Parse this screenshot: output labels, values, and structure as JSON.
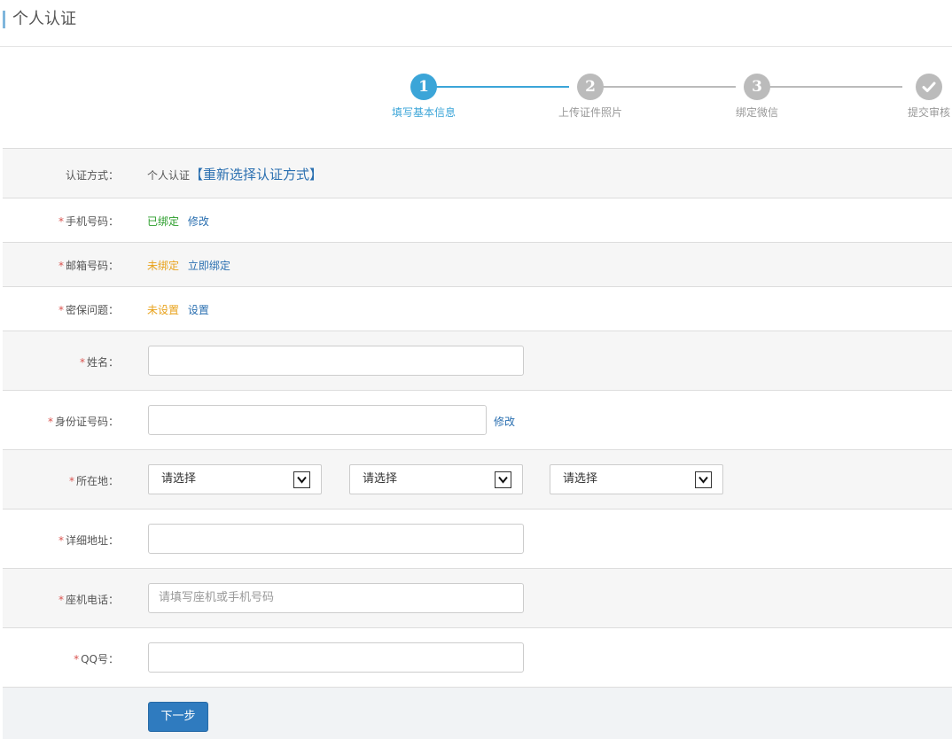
{
  "page": {
    "title": "个人认证"
  },
  "steps": [
    {
      "num": "1",
      "label": "填写基本信息",
      "state": "active"
    },
    {
      "num": "2",
      "label": "上传证件照片",
      "state": "pending"
    },
    {
      "num": "3",
      "label": "绑定微信",
      "state": "pending"
    },
    {
      "icon": "check-icon",
      "label": "提交审核",
      "state": "pending"
    }
  ],
  "form": {
    "auth_method": {
      "label": "认证方式：",
      "value": "个人认证",
      "link": "【重新选择认证方式】"
    },
    "phone": {
      "required": "*",
      "label": "手机号码：",
      "status": "已绑定",
      "link": "修改"
    },
    "email": {
      "required": "*",
      "label": "邮箱号码：",
      "status": "未绑定",
      "link": "立即绑定"
    },
    "security": {
      "required": "*",
      "label": "密保问题：",
      "status": "未设置",
      "link": "设置"
    },
    "name": {
      "required": "*",
      "label": "姓名：",
      "value": ""
    },
    "id_number": {
      "required": "*",
      "label": "身份证号码：",
      "value": "",
      "link": "修改"
    },
    "location": {
      "required": "*",
      "label": "所在地：",
      "selects": [
        "请选择",
        "请选择",
        "请选择"
      ]
    },
    "address": {
      "required": "*",
      "label": "详细地址：",
      "value": ""
    },
    "landline": {
      "required": "*",
      "label": "座机电话：",
      "placeholder": "请填写座机或手机号码"
    },
    "qq": {
      "required": "*",
      "label": "QQ号：",
      "value": ""
    }
  },
  "buttons": {
    "next": "下一步"
  },
  "colors": {
    "accent": "#3ba5d8",
    "link": "#2a6fb0",
    "bound": "#2b9d2b",
    "unbound": "#e8a21b",
    "required": "#d9534f",
    "button": "#2f7bbf"
  }
}
